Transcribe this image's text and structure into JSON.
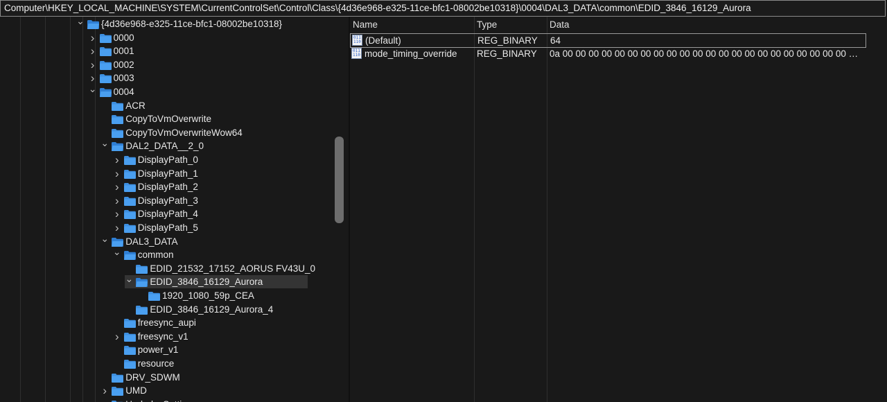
{
  "address": "Computer\\HKEY_LOCAL_MACHINE\\SYSTEM\\CurrentControlSet\\Control\\Class\\{4d36e968-e325-11ce-bfc1-08002be10318}\\0004\\DAL3_DATA\\common\\EDID_3846_16129_Aurora",
  "colors": {
    "folder": "#3d8fe0",
    "background": "#191919",
    "selected": "#343434"
  },
  "tree": {
    "nodes": [
      {
        "label": "{4d36e968-e325-11ce-bfc1-08002be10318}",
        "expander": "expanded"
      },
      {
        "label": "0000",
        "expander": "collapsed"
      },
      {
        "label": "0001",
        "expander": "collapsed"
      },
      {
        "label": "0002",
        "expander": "collapsed"
      },
      {
        "label": "0003",
        "expander": "collapsed"
      },
      {
        "label": "0004",
        "expander": "expanded"
      },
      {
        "label": "ACR",
        "expander": "none"
      },
      {
        "label": "CopyToVmOverwrite",
        "expander": "none"
      },
      {
        "label": "CopyToVmOverwriteWow64",
        "expander": "none"
      },
      {
        "label": "DAL2_DATA__2_0",
        "expander": "expanded"
      },
      {
        "label": "DisplayPath_0",
        "expander": "collapsed"
      },
      {
        "label": "DisplayPath_1",
        "expander": "collapsed"
      },
      {
        "label": "DisplayPath_2",
        "expander": "collapsed"
      },
      {
        "label": "DisplayPath_3",
        "expander": "collapsed"
      },
      {
        "label": "DisplayPath_4",
        "expander": "collapsed"
      },
      {
        "label": "DisplayPath_5",
        "expander": "collapsed"
      },
      {
        "label": "DAL3_DATA",
        "expander": "expanded"
      },
      {
        "label": "common",
        "expander": "expanded"
      },
      {
        "label": "EDID_21532_17152_AORUS FV43U_0",
        "expander": "none"
      },
      {
        "label": "EDID_3846_16129_Aurora",
        "expander": "expanded",
        "selected": true
      },
      {
        "label": "1920_1080_59p_CEA",
        "expander": "none"
      },
      {
        "label": "EDID_3846_16129_Aurora_4",
        "expander": "none"
      },
      {
        "label": "freesync_aupi",
        "expander": "none"
      },
      {
        "label": "freesync_v1",
        "expander": "collapsed"
      },
      {
        "label": "power_v1",
        "expander": "none"
      },
      {
        "label": "resource",
        "expander": "none"
      },
      {
        "label": "DRV_SDWM",
        "expander": "none"
      },
      {
        "label": "UMD",
        "expander": "collapsed"
      },
      {
        "label": "UnderlaySettings",
        "expander": "collapsed"
      }
    ]
  },
  "values": {
    "headers": {
      "name": "Name",
      "type": "Type",
      "data": "Data"
    },
    "rows": [
      {
        "name": "(Default)",
        "type": "REG_BINARY",
        "data": "64",
        "icon": "binary-value-icon",
        "selected": true
      },
      {
        "name": "mode_timing_override",
        "type": "REG_BINARY",
        "data": "0a 00 00 00 00 00 00 00 00 00 00 00 00 00 00 00 00 00 00 00 00 00 00 00 00 00 00 00 00 00 00 00 0...",
        "icon": "binary-value-icon"
      }
    ]
  }
}
